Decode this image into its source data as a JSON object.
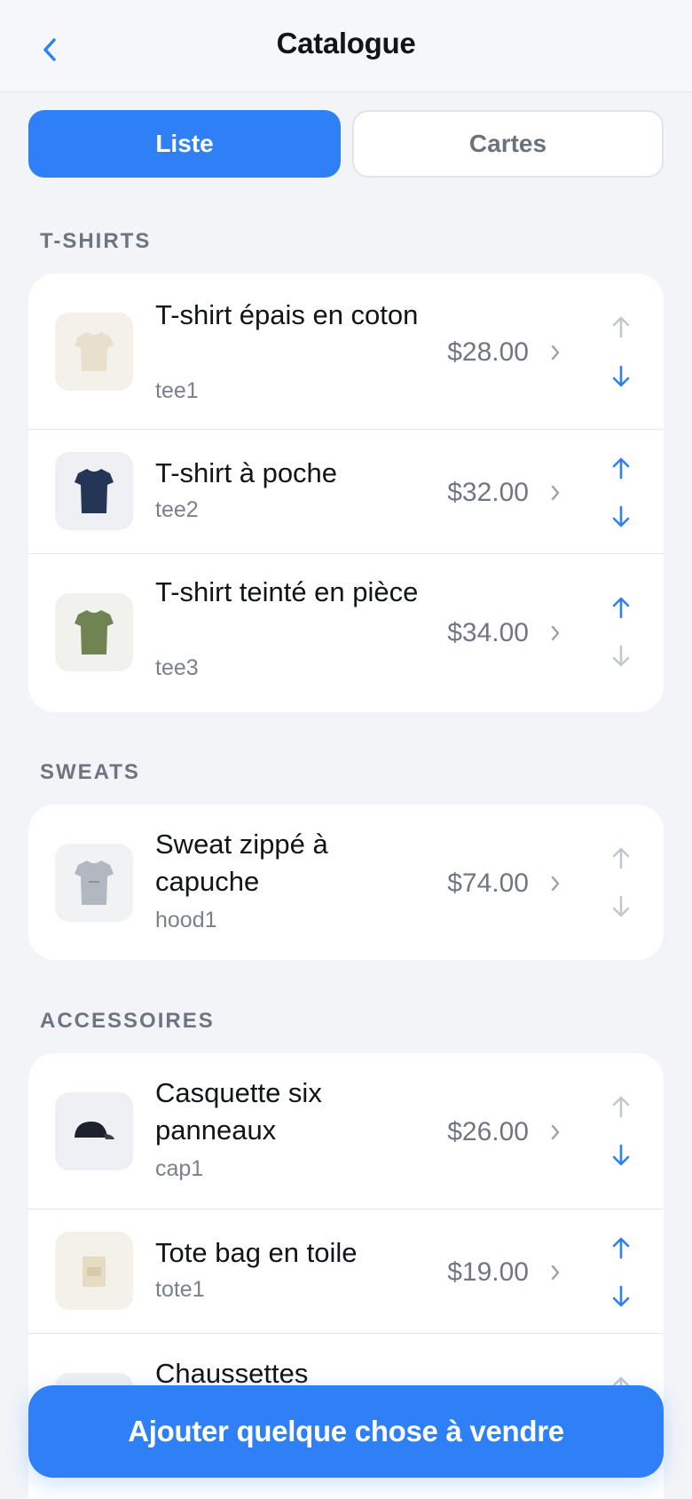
{
  "header": {
    "title": "Catalogue",
    "back_icon": "chevron-left-icon"
  },
  "view_toggle": {
    "list_label": "Liste",
    "cards_label": "Cartes",
    "selected": "Liste"
  },
  "sections": [
    {
      "label": "T-SHIRTS",
      "items": [
        {
          "name": "T-shirt épais en coton",
          "sku": "tee1",
          "price": "$28.00",
          "icon": "tshirt-icon",
          "color": "#e8dfcc",
          "up_enabled": false,
          "down_enabled": true
        },
        {
          "name": "T-shirt à poche",
          "sku": "tee2",
          "price": "$32.00",
          "icon": "tshirt-icon",
          "color": "#253556",
          "up_enabled": true,
          "down_enabled": true
        },
        {
          "name": "T-shirt teinté en pièce",
          "sku": "tee3",
          "price": "$34.00",
          "icon": "tshirt-icon",
          "color": "#6f8452",
          "up_enabled": true,
          "down_enabled": false
        }
      ]
    },
    {
      "label": "SWEATS",
      "items": [
        {
          "name": "Sweat zippé à capuche",
          "sku": "hood1",
          "price": "$74.00",
          "icon": "hoodie-icon",
          "color": "#b3b8c0",
          "up_enabled": false,
          "down_enabled": false
        }
      ]
    },
    {
      "label": "ACCESSOIRES",
      "items": [
        {
          "name": "Casquette six panneaux",
          "sku": "cap1",
          "price": "$26.00",
          "icon": "cap-icon",
          "color": "#1d222c",
          "up_enabled": false,
          "down_enabled": true
        },
        {
          "name": "Tote bag en toile",
          "sku": "tote1",
          "price": "$19.00",
          "icon": "tote-bag-icon",
          "color": "#e6dcc4",
          "up_enabled": true,
          "down_enabled": true
        },
        {
          "name": "Chaussettes",
          "sku": "",
          "price": "",
          "icon": "socks-icon",
          "color": "#c9cdd4",
          "up_enabled": false,
          "down_enabled": false
        }
      ]
    }
  ],
  "cta": {
    "label": "Ajouter quelque chose à vendre"
  },
  "colors": {
    "accent": "#2f80f7",
    "background": "#f2f4f8",
    "disabled_arrow": "#c3c7ce"
  }
}
